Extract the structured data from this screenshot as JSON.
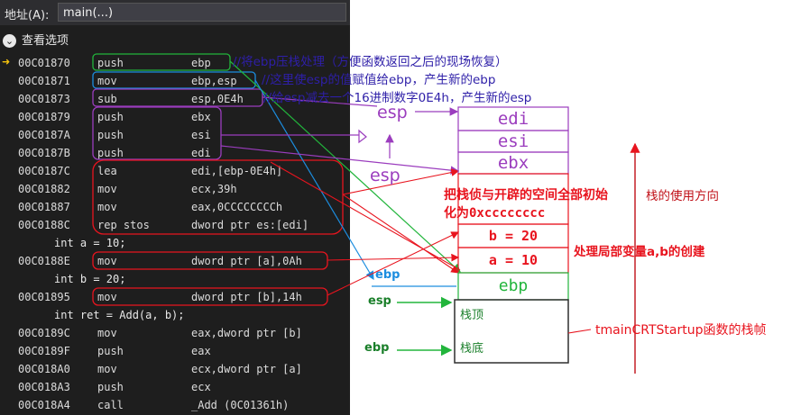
{
  "address": {
    "label": "地址(A):",
    "value": "main(...)"
  },
  "view_options": {
    "label": "查看选项",
    "icon": "chevron-down-icon"
  },
  "code_rows": [
    {
      "addr": "00C01870",
      "mnem": "push",
      "ops": "ebp"
    },
    {
      "addr": "00C01871",
      "mnem": "mov",
      "ops": "ebp,esp"
    },
    {
      "addr": "00C01873",
      "mnem": "sub",
      "ops": "esp,0E4h"
    },
    {
      "addr": "00C01879",
      "mnem": "push",
      "ops": "ebx"
    },
    {
      "addr": "00C0187A",
      "mnem": "push",
      "ops": "esi"
    },
    {
      "addr": "00C0187B",
      "mnem": "push",
      "ops": "edi"
    },
    {
      "addr": "00C0187C",
      "mnem": "lea",
      "ops": "edi,[ebp-0E4h]"
    },
    {
      "addr": "00C01882",
      "mnem": "mov",
      "ops": "ecx,39h"
    },
    {
      "addr": "00C01887",
      "mnem": "mov",
      "ops": "eax,0CCCCCCCCh"
    },
    {
      "addr": "00C0188C",
      "mnem": "rep stos",
      "ops": "dword ptr es:[edi]"
    },
    {
      "src": "int a = 10;"
    },
    {
      "addr": "00C0188E",
      "mnem": "mov",
      "ops": "dword ptr [a],0Ah"
    },
    {
      "src": "int b = 20;"
    },
    {
      "addr": "00C01895",
      "mnem": "mov",
      "ops": "dword ptr [b],14h"
    },
    {
      "src": "int ret = Add(a, b);"
    },
    {
      "addr": "00C0189C",
      "mnem": "mov",
      "ops": "eax,dword ptr [b]"
    },
    {
      "addr": "00C0189F",
      "mnem": "push",
      "ops": "eax"
    },
    {
      "addr": "00C018A0",
      "mnem": "mov",
      "ops": "ecx,dword ptr [a]"
    },
    {
      "addr": "00C018A3",
      "mnem": "push",
      "ops": "ecx"
    },
    {
      "addr": "00C018A4",
      "mnem": "call",
      "ops": "_Add (0C01361h)"
    }
  ],
  "notes": {
    "n1": "//将ebp压栈处理（方便函数返回之后的现场恢复）",
    "n2": "//这里使esp的值赋值给ebp，产生新的ebp",
    "n3": "//给esp减去一个16进制数字0E4h，产生新的esp",
    "init": "把栈侦与开辟的空间全部初始化为0xcccccccc",
    "locals": "处理局部变量a,b的创建",
    "direction": "栈的使用方向",
    "frame": "tmainCRTStartup函数的栈帧"
  },
  "stack": {
    "edi": "edi",
    "esi": "esi",
    "ebx": "ebx",
    "b": "b  =  20",
    "a": "a  =  10",
    "ebp": "ebp",
    "top": "栈顶",
    "bottom": "栈底"
  },
  "pointers": {
    "esp1": "esp",
    "esp2": "esp",
    "ebp1": "ebp",
    "esp3": "esp",
    "ebp2": "ebp"
  },
  "colors": {
    "red": "#e8141e",
    "green": "#22b53c",
    "purple": "#9b3dbe",
    "blue": "#1c8ddf",
    "navy": "#2e1fa8"
  }
}
